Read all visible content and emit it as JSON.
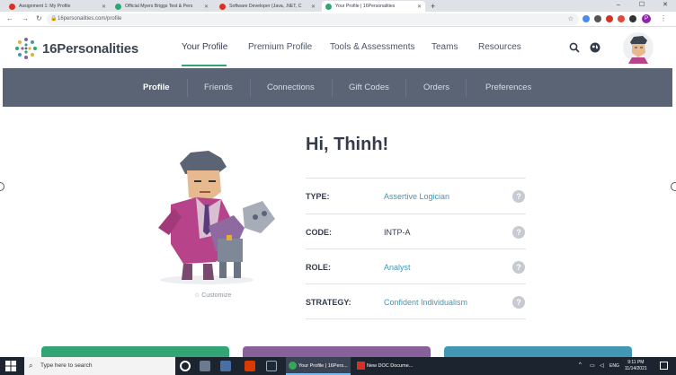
{
  "browser": {
    "tabs": [
      {
        "title": "Assignment 1: My Profile",
        "fav_color": "#d93025"
      },
      {
        "title": "Official Myers Briggs Test & Pers",
        "fav_color": "#33a474"
      },
      {
        "title": "Software Developer (Java, .NET, C",
        "fav_color": "#d93025"
      },
      {
        "title": "Your Profile | 16Personalities",
        "fav_color": "#33a474"
      }
    ],
    "new_tab": "+",
    "url": "16personalities.com/profile",
    "window_controls": {
      "min": "–",
      "max": "☐",
      "close": "✕"
    }
  },
  "site": {
    "logo_text": "16Personalities",
    "nav": [
      "Your Profile",
      "Premium Profile",
      "Tools & Assessments",
      "Teams",
      "Resources"
    ],
    "subnav": [
      "Profile",
      "Friends",
      "Connections",
      "Gift Codes",
      "Orders",
      "Preferences"
    ]
  },
  "profile": {
    "greeting": "Hi, Thinh!",
    "customize": "Customize",
    "rows": [
      {
        "label": "TYPE:",
        "value": "Assertive Logician",
        "link": true
      },
      {
        "label": "CODE:",
        "value": "INTP-A",
        "link": false
      },
      {
        "label": "ROLE:",
        "value": "Analyst",
        "link": true
      },
      {
        "label": "STRATEGY:",
        "value": "Confident Individualism",
        "link": true
      }
    ],
    "help_glyph": "?"
  },
  "colors": {
    "accent_green": "#33a474",
    "link_blue": "#4298b4",
    "card_green": "#33a474",
    "card_purple": "#88619a",
    "card_blue": "#4298b4"
  },
  "taskbar": {
    "search_placeholder": "Type here to search",
    "apps": [
      {
        "label": "Your Profile | 16Pers..."
      },
      {
        "label": "New DOC Docume..."
      }
    ],
    "lang": "ENG",
    "time": "9:11 PM",
    "date": "11/14/2021"
  }
}
